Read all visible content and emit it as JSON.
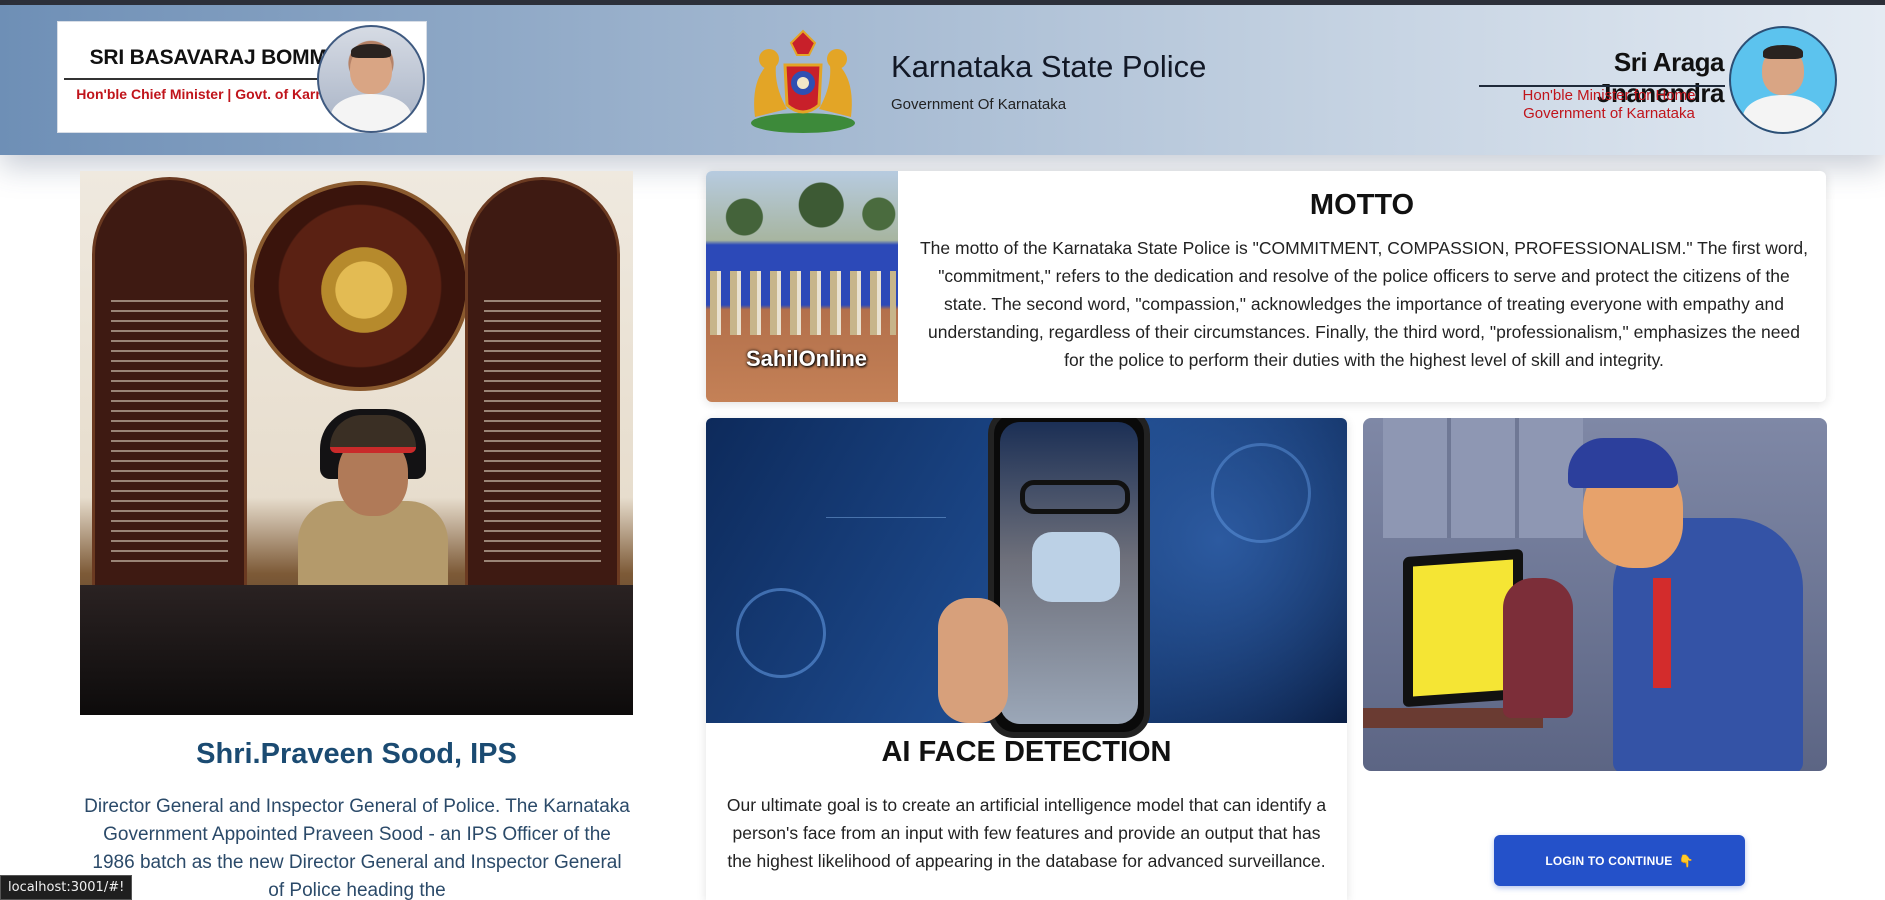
{
  "header": {
    "chief_minister": {
      "name": "SRI BASAVARAJ BOMMAI",
      "title": "Hon'ble Chief Minister | Govt. of Karnataka"
    },
    "brand": {
      "title": "Karnataka State Police",
      "subtitle": "Government Of Karnataka"
    },
    "home_minister": {
      "name": "Sri Araga Jnanendra",
      "title_line1": "Hon'ble Minister for Home",
      "title_line2": "Government of Karnataka"
    }
  },
  "director": {
    "name": "Shri.Praveen Sood, IPS",
    "description": "Director General and Inspector General of Police. The Karnataka Government Appointed Praveen Sood - an IPS Officer of the 1986 batch as the new Director General and Inspector General of Police heading the"
  },
  "motto": {
    "title": "MOTTO",
    "text": "The motto of the Karnataka State Police is \"COMMITMENT, COMPASSION, PROFESSIONALISM.\" The first word, \"commitment,\" refers to the dedication and resolve of the police officers to serve and protect the citizens of the state. The second word, \"compassion,\" acknowledges the importance of treating everyone with empathy and understanding, regardless of their circumstances. Finally, the third word, \"professionalism,\" emphasizes the need for the police to perform their duties with the highest level of skill and integrity.",
    "image_watermark": "SahilOnline"
  },
  "ai_card": {
    "title": "AI FACE DETECTION",
    "text": "Our ultimate goal is to create an artificial intelligence model that can identify a person's face from an input with few features and provide an output that has the highest likelihood of appearing in the database for advanced surveillance."
  },
  "login": {
    "label": "LOGIN TO CONTINUE",
    "icon": "👇",
    "color": "#2451c9"
  },
  "status_bar": {
    "url": "localhost:3001/#!"
  },
  "colors": {
    "accent_red": "#c0141b",
    "heading_blue": "#1b4b72"
  }
}
